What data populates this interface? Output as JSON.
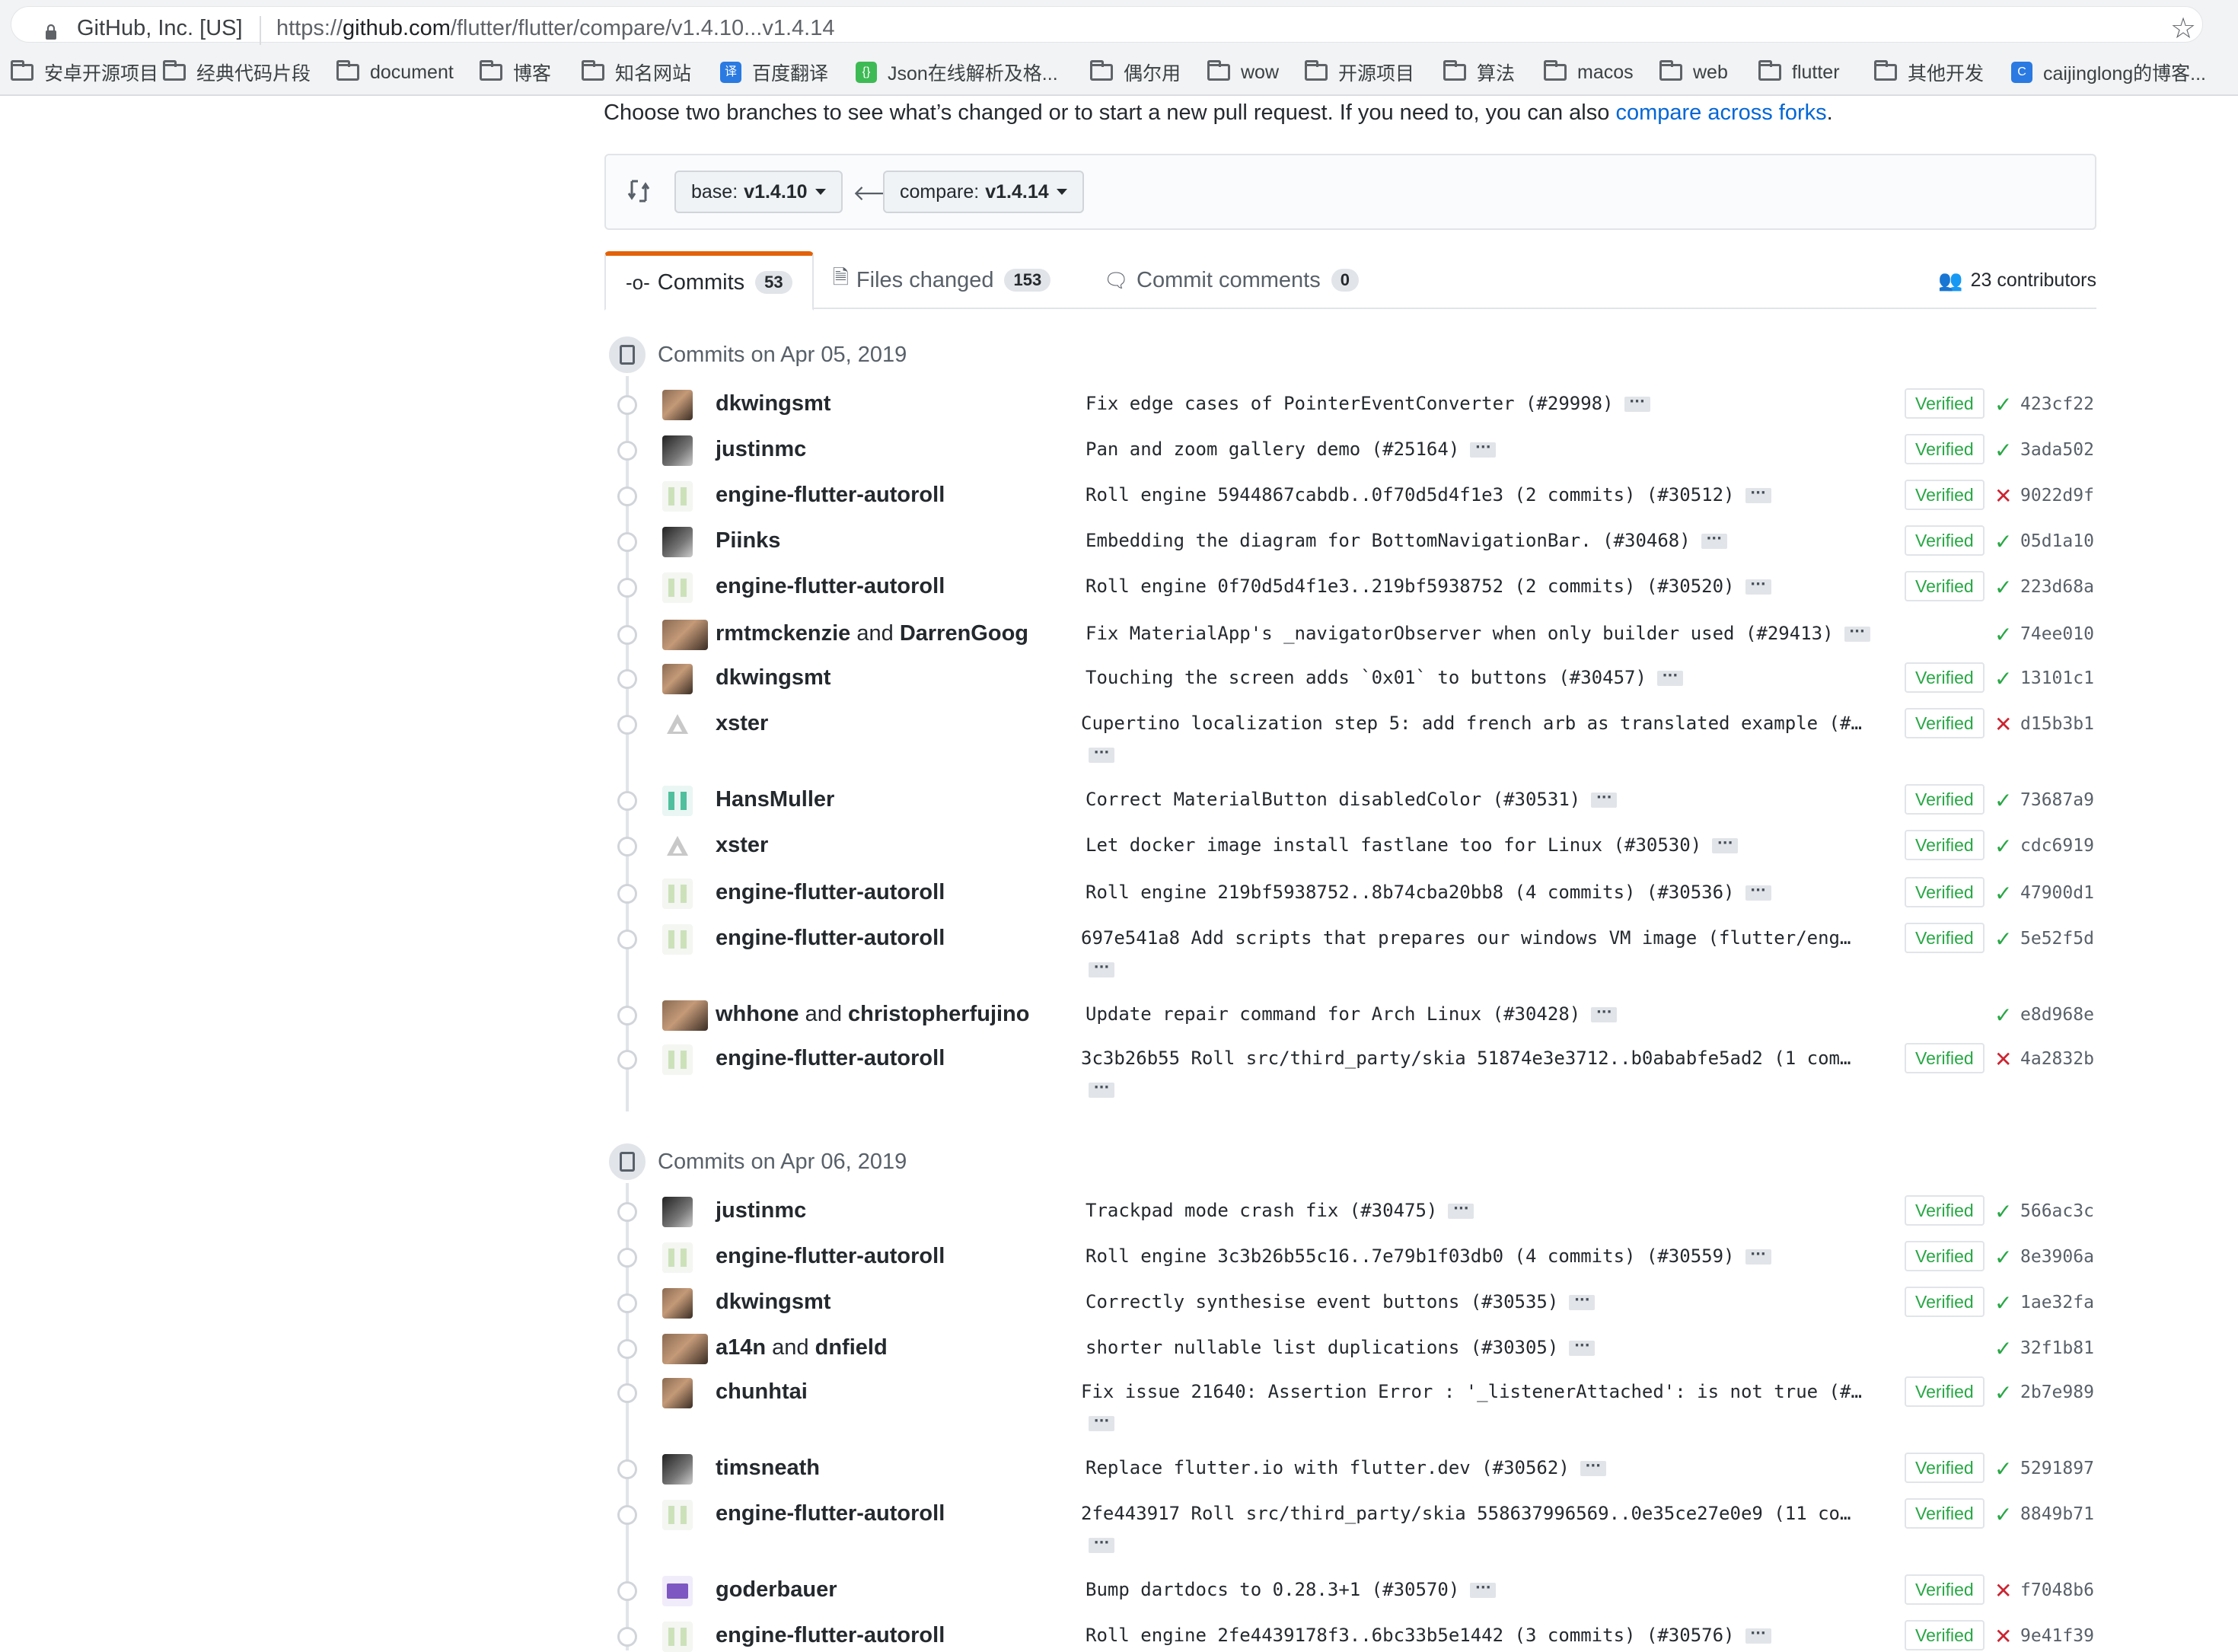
{
  "browser": {
    "site_identity": "GitHub, Inc. [US]",
    "url_prefix": "https://",
    "url_domain": "github.com",
    "url_path": "/flutter/flutter/compare/v1.4.10...v1.4.14"
  },
  "bookmarks": [
    {
      "label": "安卓开源项目",
      "icon": "folder-icon"
    },
    {
      "label": "经典代码片段",
      "icon": "folder-icon"
    },
    {
      "label": "document",
      "icon": "folder-icon"
    },
    {
      "label": "博客",
      "icon": "folder-icon"
    },
    {
      "label": "知名网站",
      "icon": "folder-icon"
    },
    {
      "label": "百度翻译",
      "icon": "translate-icon"
    },
    {
      "label": "Json在线解析及格...",
      "icon": "json-icon"
    },
    {
      "label": "偶尔用",
      "icon": "folder-icon"
    },
    {
      "label": "wow",
      "icon": "folder-icon"
    },
    {
      "label": "开源项目",
      "icon": "folder-icon"
    },
    {
      "label": "算法",
      "icon": "folder-icon"
    },
    {
      "label": "macos",
      "icon": "folder-icon"
    },
    {
      "label": "web",
      "icon": "folder-icon"
    },
    {
      "label": "flutter",
      "icon": "folder-icon"
    },
    {
      "label": "其他开发",
      "icon": "folder-icon"
    },
    {
      "label": "caijinglong的博客...",
      "icon": "blog-icon"
    }
  ],
  "intro": {
    "text": "Choose two branches to see what’s changed or to start a new pull request. If you need to, you can also ",
    "link": "compare across forks",
    "end": "."
  },
  "range": {
    "base_label": "base:",
    "base_value": "v1.4.10",
    "compare_label": "compare:",
    "compare_value": "v1.4.14"
  },
  "tabs": [
    {
      "label": "Commits",
      "count": "53",
      "icon": "commit-icon"
    },
    {
      "label": "Files changed",
      "count": "153",
      "icon": "file-diff-icon"
    },
    {
      "label": "Commit comments",
      "count": "0",
      "icon": "comment-icon"
    }
  ],
  "contributors": "23 contributors",
  "verified_label": "Verified",
  "colors": {
    "accent": "#0366d6",
    "success": "#28a745",
    "failure": "#cb2431",
    "tab_active": "#e36209"
  },
  "groups": [
    {
      "title": "Commits on Apr 05, 2019",
      "commits": [
        {
          "author": "dkwingsmt",
          "message": "Fix edge cases of PointerEventConverter (#29998)",
          "verified": true,
          "status": "success",
          "sha": "423cf22"
        },
        {
          "author": "justinmc",
          "message": "Pan and zoom gallery demo (#25164)",
          "verified": true,
          "status": "success",
          "sha": "3ada502"
        },
        {
          "author": "engine-flutter-autoroll",
          "message": "Roll engine 5944867cabdb..0f70d5d4f1e3 (2 commits) (#30512)",
          "verified": true,
          "status": "failure",
          "sha": "9022d9f"
        },
        {
          "author": "Piinks",
          "message": "Embedding the diagram for BottomNavigationBar. (#30468)",
          "verified": true,
          "status": "success",
          "sha": "05d1a10"
        },
        {
          "author": "engine-flutter-autoroll",
          "message": "Roll engine 0f70d5d4f1e3..219bf5938752 (2 commits) (#30520)",
          "verified": true,
          "status": "success",
          "sha": "223d68a"
        },
        {
          "author": "rmtmckenzie",
          "coauthor": "DarrenGoog",
          "message": "Fix MaterialApp's _navigatorObserver when only builder used (#29413)",
          "verified": false,
          "status": "success",
          "sha": "74ee010"
        },
        {
          "author": "dkwingsmt",
          "message": "Touching the screen adds `0x01` to buttons (#30457)",
          "verified": true,
          "status": "success",
          "sha": "13101c1"
        },
        {
          "author": "xster",
          "message": "Cupertino localization step 5: add french arb as translated example (#…",
          "verified": true,
          "status": "failure",
          "sha": "d15b3b1",
          "wrapped": true
        },
        {
          "author": "HansMuller",
          "message": "Correct MaterialButton disabledColor (#30531)",
          "verified": true,
          "status": "success",
          "sha": "73687a9"
        },
        {
          "author": "xster",
          "message": "Let docker image install fastlane too for Linux (#30530)",
          "verified": true,
          "status": "success",
          "sha": "cdc6919"
        },
        {
          "author": "engine-flutter-autoroll",
          "message": "Roll engine 219bf5938752..8b74cba20bb8 (4 commits) (#30536)",
          "verified": true,
          "status": "success",
          "sha": "47900d1"
        },
        {
          "author": "engine-flutter-autoroll",
          "message": "697e541a8 Add scripts that prepares our windows VM image (flutter/eng…",
          "verified": true,
          "status": "success",
          "sha": "5e52f5d",
          "wrapped": true
        },
        {
          "author": "whhone",
          "coauthor": "christopherfujino",
          "message": "Update repair command for Arch Linux (#30428)",
          "verified": false,
          "status": "success",
          "sha": "e8d968e"
        },
        {
          "author": "engine-flutter-autoroll",
          "message": "3c3b26b55 Roll src/third_party/skia 51874e3e3712..b0ababfe5ad2 (1 com…",
          "verified": true,
          "status": "failure",
          "sha": "4a2832b",
          "wrapped": true
        }
      ]
    },
    {
      "title": "Commits on Apr 06, 2019",
      "commits": [
        {
          "author": "justinmc",
          "message": "Trackpad mode crash fix (#30475)",
          "verified": true,
          "status": "success",
          "sha": "566ac3c"
        },
        {
          "author": "engine-flutter-autoroll",
          "message": "Roll engine 3c3b26b55c16..7e79b1f03db0 (4 commits) (#30559)",
          "verified": true,
          "status": "success",
          "sha": "8e3906a"
        },
        {
          "author": "dkwingsmt",
          "message": "Correctly synthesise event buttons (#30535)",
          "verified": true,
          "status": "success",
          "sha": "1ae32fa"
        },
        {
          "author": "a14n",
          "coauthor": "dnfield",
          "message": "shorter nullable list duplications (#30305)",
          "verified": false,
          "status": "success",
          "sha": "32f1b81"
        },
        {
          "author": "chunhtai",
          "message": "Fix issue 21640: Assertion Error : '_listenerAttached': is not true (#…",
          "verified": true,
          "status": "success",
          "sha": "2b7e989",
          "wrapped": true
        },
        {
          "author": "timsneath",
          "message": "Replace flutter.io with flutter.dev (#30562)",
          "verified": true,
          "status": "success",
          "sha": "5291897"
        },
        {
          "author": "engine-flutter-autoroll",
          "message": "2fe443917 Roll src/third_party/skia 558637996569..0e35ce27e0e9 (11 co…",
          "verified": true,
          "status": "success",
          "sha": "8849b71",
          "wrapped": true
        },
        {
          "author": "goderbauer",
          "message": "Bump dartdocs to 0.28.3+1 (#30570)",
          "verified": true,
          "status": "failure",
          "sha": "f7048b6"
        },
        {
          "author": "engine-flutter-autoroll",
          "message": "Roll engine 2fe4439178f3..6bc33b5e1442 (3 commits) (#30576)",
          "verified": true,
          "status": "failure",
          "sha": "9e41f39"
        }
      ]
    }
  ]
}
